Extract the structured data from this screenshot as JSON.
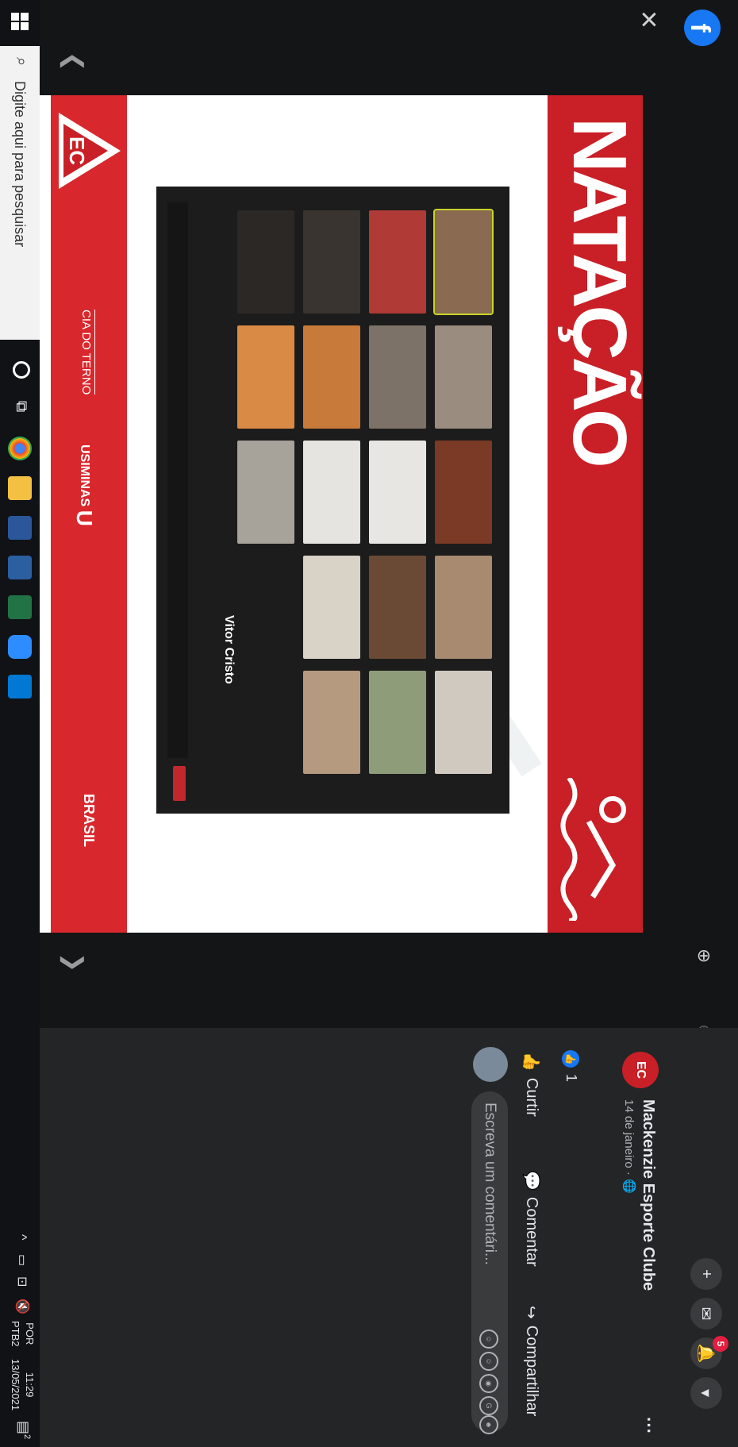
{
  "viewer": {
    "image": {
      "title": "NATAÇÃO",
      "participant_name": "Vitor Cristo",
      "sponsors": {
        "cia": "CIA DO TERNO",
        "usiminas": "USIMINAS",
        "brasil": "BRASIL"
      }
    }
  },
  "post": {
    "page_name": "Mackenzie Esporte Clube",
    "date": "14 de janeiro ·",
    "likes": "1",
    "actions": {
      "like": "Curtir",
      "comment": "Comentar",
      "share": "Compartilhar"
    },
    "comment_placeholder": "Escreva um comentári...",
    "notification_count": "5"
  },
  "taskbar": {
    "search_placeholder": "Digite aqui para pesquisar",
    "language": "POR",
    "layout": "PTB2",
    "time": "11:29",
    "date": "13/05/2021",
    "notification_count": "2"
  },
  "colors": {
    "accent_red": "#c91f26",
    "facebook_blue": "#1877f2"
  }
}
